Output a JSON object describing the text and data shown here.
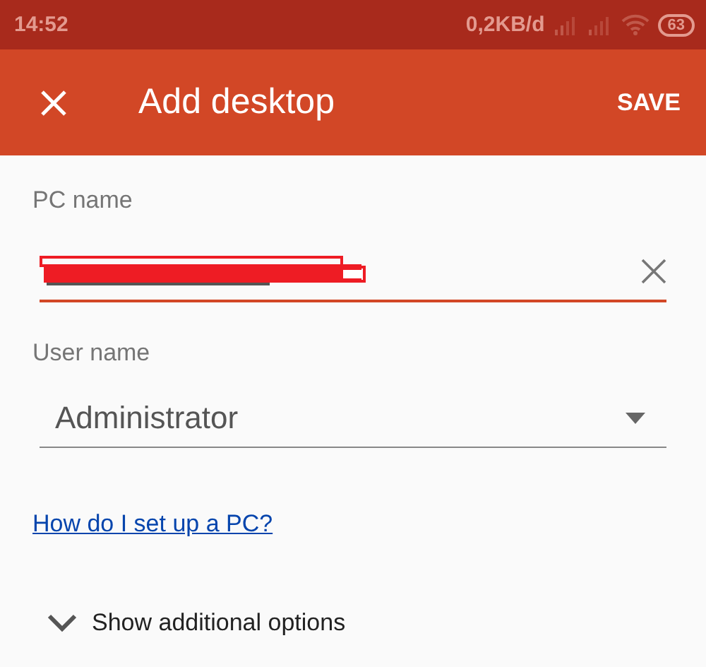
{
  "status_bar": {
    "time": "14:52",
    "data_rate": "0,2KB/d",
    "battery": "63"
  },
  "app_bar": {
    "title": "Add desktop",
    "action": "SAVE"
  },
  "pc_name": {
    "label": "PC name",
    "focused": true,
    "redacted": true
  },
  "user_name": {
    "label": "User name",
    "value": "Administrator"
  },
  "help_link": "How do I set up a PC?",
  "options_toggle": {
    "label": "Show additional options",
    "expanded": false
  }
}
